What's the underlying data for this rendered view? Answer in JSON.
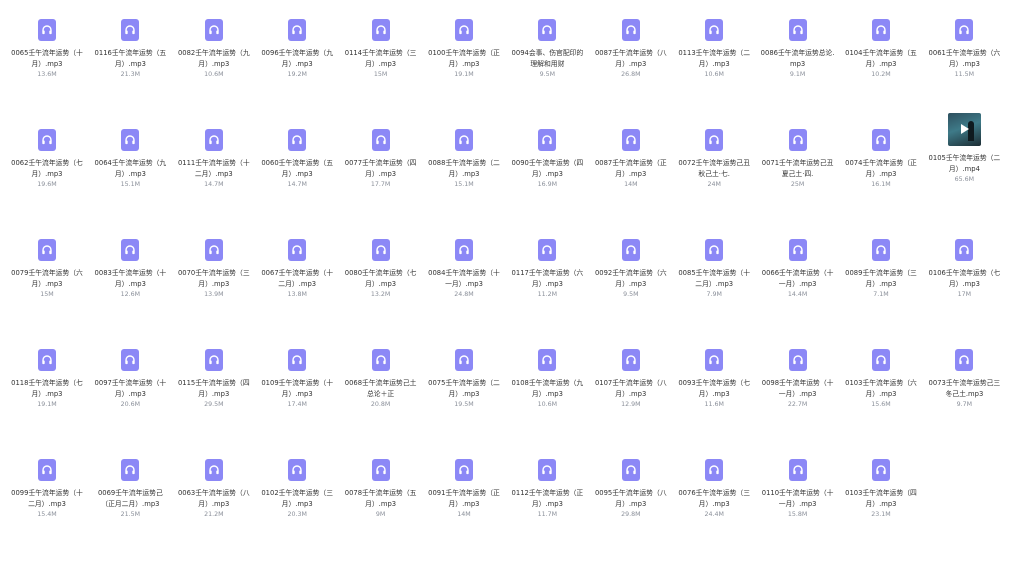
{
  "accent_color": "#8c88f6",
  "files": [
    {
      "name": "0065壬午流年运势（十月）.mp3",
      "size": "13.6M",
      "icon": "audio-file-icon"
    },
    {
      "name": "0116壬午流年运势（五月）.mp3",
      "size": "21.3M",
      "icon": "audio-file-icon"
    },
    {
      "name": "0082壬午流年运势（九月）.mp3",
      "size": "10.6M",
      "icon": "audio-file-icon"
    },
    {
      "name": "0096壬午流年运势（九月）.mp3",
      "size": "19.2M",
      "icon": "audio-file-icon"
    },
    {
      "name": "0114壬午流年运势（三月）.mp3",
      "size": "15M",
      "icon": "audio-file-icon"
    },
    {
      "name": "0100壬午流年运势（正月）.mp3",
      "size": "19.1M",
      "icon": "audio-file-icon"
    },
    {
      "name": "0094会事、伤官配印的理解和用财",
      "size": "9.5M",
      "icon": "audio-file-icon"
    },
    {
      "name": "0087壬午流年运势（八月）.mp3",
      "size": "26.8M",
      "icon": "audio-file-icon"
    },
    {
      "name": "0113壬午流年运势（二月）.mp3",
      "size": "10.6M",
      "icon": "audio-file-icon"
    },
    {
      "name": "0086壬午流年运势总论.mp3",
      "size": "9.1M",
      "icon": "audio-file-icon"
    },
    {
      "name": "0104壬午流年运势（五月）.mp3",
      "size": "10.2M",
      "icon": "audio-file-icon"
    },
    {
      "name": "0061壬午流年运势（六月）.mp3",
      "size": "11.5M",
      "icon": "audio-file-icon"
    },
    {
      "name": "0062壬午流年运势（七月）.mp3",
      "size": "19.6M",
      "icon": "audio-file-icon"
    },
    {
      "name": "0064壬午流年运势（九月）.mp3",
      "size": "15.1M",
      "icon": "audio-file-icon"
    },
    {
      "name": "0111壬午流年运势（十二月）.mp3",
      "size": "14.7M",
      "icon": "audio-file-icon"
    },
    {
      "name": "0060壬午流年运势（五月）.mp3",
      "size": "14.7M",
      "icon": "audio-file-icon"
    },
    {
      "name": "0077壬午流年运势（四月）.mp3",
      "size": "17.7M",
      "icon": "audio-file-icon"
    },
    {
      "name": "0088壬午流年运势（二月）.mp3",
      "size": "15.1M",
      "icon": "audio-file-icon"
    },
    {
      "name": "0090壬午流年运势（四月）.mp3",
      "size": "16.9M",
      "icon": "audio-file-icon"
    },
    {
      "name": "0087壬午流年运势（正月）.mp3",
      "size": "14M",
      "icon": "audio-file-icon"
    },
    {
      "name": "0072壬午流年运势己丑秋己土·七.",
      "size": "24M",
      "icon": "audio-file-icon"
    },
    {
      "name": "0071壬午流年运势己丑夏己土·四.",
      "size": "25M",
      "icon": "audio-file-icon"
    },
    {
      "name": "0074壬午流年运势（正月）.mp3",
      "size": "16.1M",
      "icon": "audio-file-icon"
    },
    {
      "name": "0105壬午流年运势（二月）.mp4",
      "size": "65.6M",
      "icon": "video-thumbnail"
    },
    {
      "name": "0079壬午流年运势（六月）.mp3",
      "size": "15M",
      "icon": "audio-file-icon"
    },
    {
      "name": "0083壬午流年运势（十月）.mp3",
      "size": "12.6M",
      "icon": "audio-file-icon"
    },
    {
      "name": "0070壬午流年运势（三月）.mp3",
      "size": "13.9M",
      "icon": "audio-file-icon"
    },
    {
      "name": "0067壬午流年运势（十二月）.mp3",
      "size": "13.8M",
      "icon": "audio-file-icon"
    },
    {
      "name": "0080壬午流年运势（七月）.mp3",
      "size": "13.2M",
      "icon": "audio-file-icon"
    },
    {
      "name": "0084壬午流年运势（十一月）.mp3",
      "size": "24.8M",
      "icon": "audio-file-icon"
    },
    {
      "name": "0117壬午流年运势（六月）.mp3",
      "size": "11.2M",
      "icon": "audio-file-icon"
    },
    {
      "name": "0092壬午流年运势（六月）.mp3",
      "size": "9.5M",
      "icon": "audio-file-icon"
    },
    {
      "name": "0085壬午流年运势（十二月）.mp3",
      "size": "7.9M",
      "icon": "audio-file-icon"
    },
    {
      "name": "0066壬午流年运势（十一月）.mp3",
      "size": "14.4M",
      "icon": "audio-file-icon"
    },
    {
      "name": "0089壬午流年运势（三月）.mp3",
      "size": "7.1M",
      "icon": "audio-file-icon"
    },
    {
      "name": "0106壬午流年运势（七月）.mp3",
      "size": "17M",
      "icon": "audio-file-icon"
    },
    {
      "name": "0118壬午流年运势（七月）.mp3",
      "size": "19.1M",
      "icon": "audio-file-icon"
    },
    {
      "name": "0097壬午流年运势（十月）.mp3",
      "size": "20.6M",
      "icon": "audio-file-icon"
    },
    {
      "name": "0115壬午流年运势（四月）.mp3",
      "size": "29.5M",
      "icon": "audio-file-icon"
    },
    {
      "name": "0109壬午流年运势（十月）.mp3",
      "size": "17.4M",
      "icon": "audio-file-icon"
    },
    {
      "name": "0068壬午流年运势己土总论＋正",
      "size": "20.8M",
      "icon": "audio-file-icon"
    },
    {
      "name": "0075壬午流年运势（二月）.mp3",
      "size": "19.5M",
      "icon": "audio-file-icon"
    },
    {
      "name": "0108壬午流年运势（九月）.mp3",
      "size": "10.6M",
      "icon": "audio-file-icon"
    },
    {
      "name": "0107壬午流年运势（八月）.mp3",
      "size": "12.9M",
      "icon": "audio-file-icon"
    },
    {
      "name": "0093壬午流年运势（七月）.mp3",
      "size": "11.6M",
      "icon": "audio-file-icon"
    },
    {
      "name": "0098壬午流年运势（十一月）.mp3",
      "size": "22.7M",
      "icon": "audio-file-icon"
    },
    {
      "name": "0103壬午流年运势（六月）.mp3",
      "size": "15.6M",
      "icon": "audio-file-icon"
    },
    {
      "name": "0073壬午流年运势己三冬己土.mp3",
      "size": "9.7M",
      "icon": "audio-file-icon"
    },
    {
      "name": "0099壬午流年运势（十二月）.mp3",
      "size": "15.4M",
      "icon": "audio-file-icon"
    },
    {
      "name": "0069壬午流年运势己（正月二月）.mp3",
      "size": "21.5M",
      "icon": "audio-file-icon"
    },
    {
      "name": "0063壬午流年运势（八月）.mp3",
      "size": "21.2M",
      "icon": "audio-file-icon"
    },
    {
      "name": "0102壬午流年运势（三月）.mp3",
      "size": "20.3M",
      "icon": "audio-file-icon"
    },
    {
      "name": "0078壬午流年运势（五月）.mp3",
      "size": "9M",
      "icon": "audio-file-icon"
    },
    {
      "name": "0091壬午流年运势（正月）.mp3",
      "size": "14M",
      "icon": "audio-file-icon"
    },
    {
      "name": "0112壬午流年运势（正月）.mp3",
      "size": "11.7M",
      "icon": "audio-file-icon"
    },
    {
      "name": "0095壬午流年运势（八月）.mp3",
      "size": "29.8M",
      "icon": "audio-file-icon"
    },
    {
      "name": "0076壬午流年运势（三月）.mp3",
      "size": "24.4M",
      "icon": "audio-file-icon"
    },
    {
      "name": "0110壬午流年运势（十一月）.mp3",
      "size": "15.8M",
      "icon": "audio-file-icon"
    },
    {
      "name": "0103壬午流年运势（四月）.mp3",
      "size": "23.1M",
      "icon": "audio-file-icon"
    }
  ]
}
